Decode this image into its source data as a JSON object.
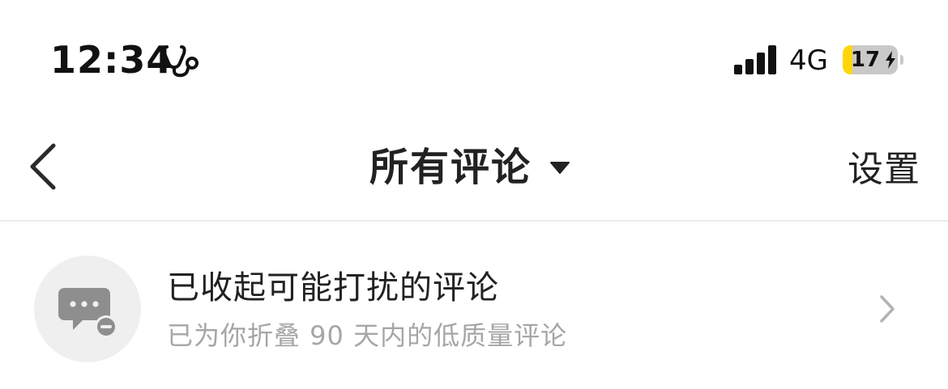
{
  "status_bar": {
    "time": "12:34",
    "network": "4G",
    "battery_level": "17",
    "battery_fraction": 0.17,
    "battery_color": "#ffd60a",
    "icons": [
      "stethoscope-icon",
      "signal-icon",
      "lightning-icon"
    ]
  },
  "nav": {
    "title": "所有评论",
    "settings_label": "设置",
    "back_icon": "chevron-left-icon",
    "dropdown_icon": "caret-down-icon"
  },
  "list": {
    "items": [
      {
        "title": "已收起可能打扰的评论",
        "subtitle": "已为你折叠 90 天内的低质量评论",
        "icon": "folded-comment-icon",
        "trailing_icon": "chevron-right-icon"
      }
    ]
  },
  "colors": {
    "background": "#ffffff",
    "text_primary": "#222222",
    "text_secondary": "#a6a6a6",
    "divider": "#ececec",
    "avatar_bg": "#efefef",
    "icon_gray": "#8e8e8e"
  }
}
